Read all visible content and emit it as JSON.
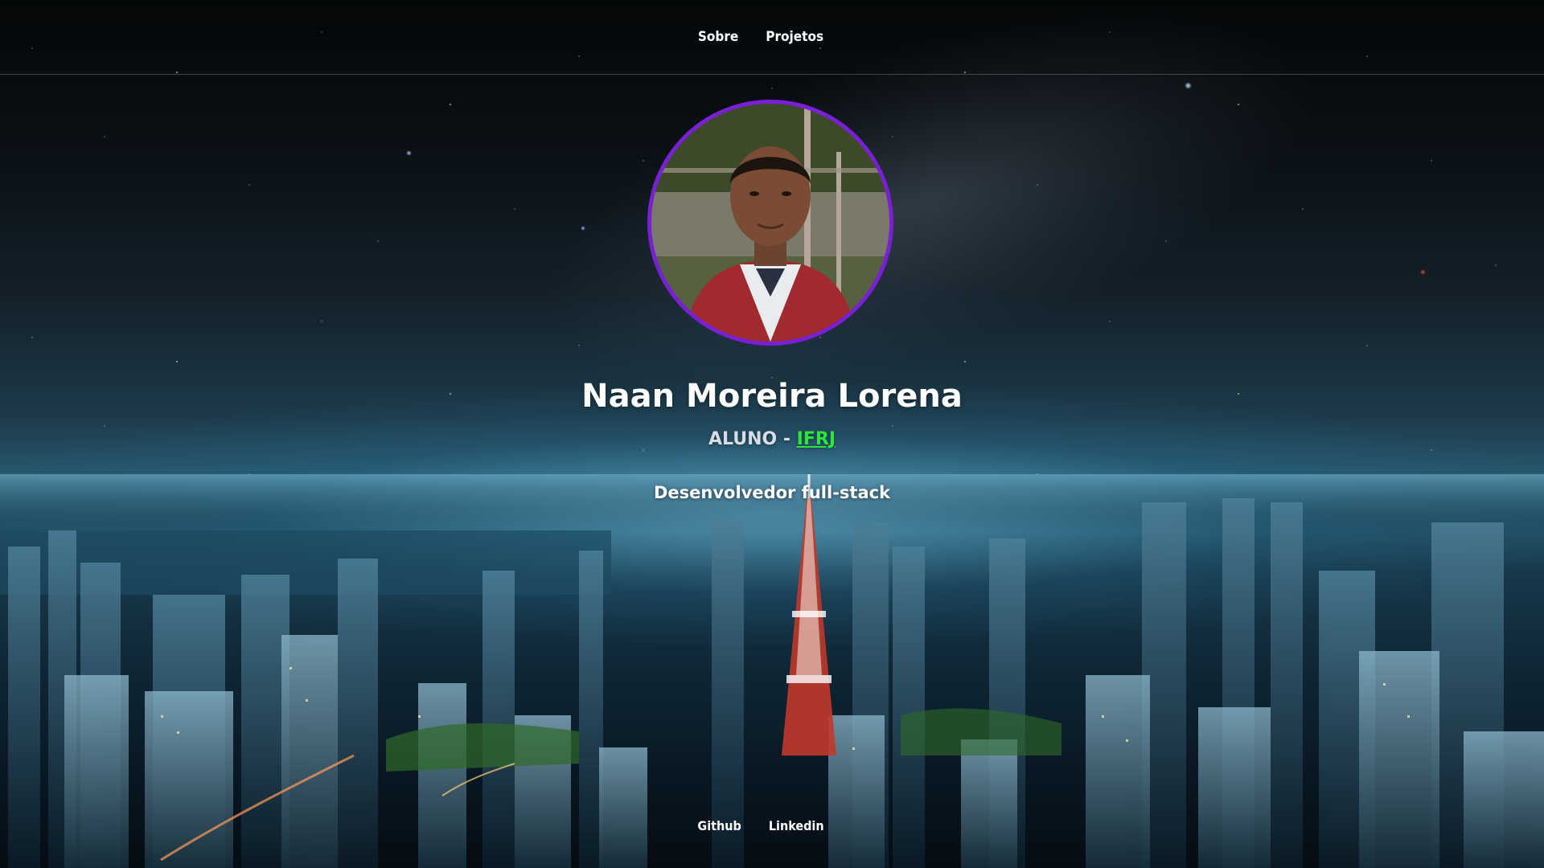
{
  "nav": {
    "items": [
      {
        "label": "Sobre"
      },
      {
        "label": "Projetos"
      }
    ]
  },
  "profile": {
    "name": "Naan Moreira Lorena",
    "role_prefix": "ALUNO - ",
    "institution": "IFRJ",
    "tagline": "Desenvolvedor full-stack",
    "photo_icon": "profile-photo"
  },
  "footer": {
    "links": [
      {
        "label": "Github"
      },
      {
        "label": "Linkedin"
      }
    ]
  },
  "colors": {
    "avatar_border": "#7a1fd6",
    "institution_link": "#2ee63a",
    "text": "#ffffff"
  }
}
